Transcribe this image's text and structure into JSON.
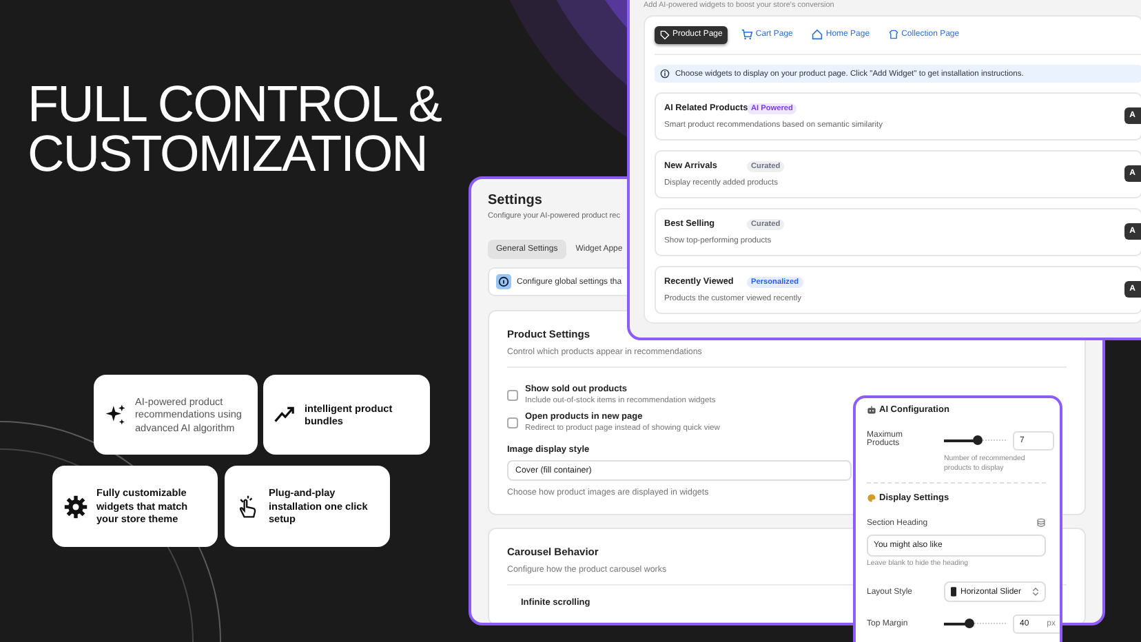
{
  "headline_lines": [
    "FULL CONTROL &",
    "CUSTOMIZATION"
  ],
  "features": [
    {
      "text": "AI-powered product recommendations using advanced AI algorithm",
      "bold": false
    },
    {
      "text": "intelligent product bundles",
      "bold": true
    },
    {
      "text": "Fully customizable widgets that match your store theme",
      "bold": true
    },
    {
      "text": "Plug-and-play installation one click setup",
      "bold": true
    }
  ],
  "widgets_window": {
    "subtitle": "Add AI-powered widgets to boost your store's conversion",
    "tabs": [
      {
        "label": "Product Page",
        "selected": true
      },
      {
        "label": "Cart Page",
        "selected": false
      },
      {
        "label": "Home Page",
        "selected": false
      },
      {
        "label": "Collection Page",
        "selected": false
      }
    ],
    "notice": "Choose widgets to display on your product page. Click \"Add Widget\" to get installation instructions.",
    "widgets": [
      {
        "name": "AI Related Products",
        "badge": "AI Powered",
        "color": "#7c3aed",
        "description": "Smart product recommendations based on semantic similarity",
        "button": "A"
      },
      {
        "name": "New Arrivals",
        "badge": "Curated",
        "color": "#6b7280",
        "description": "Display recently added products",
        "button": "A"
      },
      {
        "name": "Best Selling",
        "badge": "Curated",
        "color": "#6b7280",
        "description": "Show top-performing products",
        "button": "A"
      },
      {
        "name": "Recently Viewed",
        "badge": "Personalized",
        "color": "#2563eb",
        "description": "Products the customer viewed recently",
        "button": "A"
      }
    ]
  },
  "settings_window": {
    "title": "Settings",
    "subtitle": "Configure your AI-powered product rec",
    "tabs": [
      {
        "label": "General Settings",
        "selected": true
      },
      {
        "label": "Widget Appe",
        "selected": false
      }
    ],
    "notice": "Configure global settings tha",
    "product_settings": {
      "title": "Product Settings",
      "description": "Control which products appear in recommendations",
      "options": [
        {
          "label": "Show sold out products",
          "description": "Include out-of-stock items in recommendation widgets",
          "checked": false
        },
        {
          "label": "Open products in new page",
          "description": "Redirect to product page instead of showing quick view",
          "checked": false
        }
      ],
      "image_style": {
        "label": "Image display style",
        "value": "Cover (fill container)",
        "hint": "Choose how product images are displayed in widgets"
      }
    },
    "carousel": {
      "title": "Carousel Behavior",
      "description": "Configure how the product carousel works",
      "first_option": "Infinite scrolling"
    }
  },
  "ai_panel": {
    "title": "AI Configuration",
    "max_products": {
      "label": "Maximum Products",
      "level": 0.55,
      "value": "7",
      "hint": "Number of recommended products to display"
    },
    "display_title": "Display Settings",
    "section_heading": {
      "label": "Section Heading",
      "value": "You might also like",
      "hint": "Leave blank to hide the heading"
    },
    "layout_style": {
      "label": "Layout Style",
      "value": "Horizontal Slider"
    },
    "top_margin": {
      "label": "Top Margin",
      "level": 0.4,
      "value": "40",
      "unit": "px"
    }
  }
}
